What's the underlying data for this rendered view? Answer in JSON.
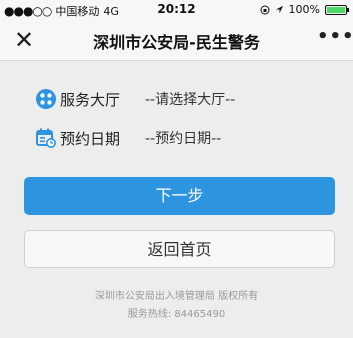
{
  "status_bar": {
    "signal": "●●●○○",
    "carrier": "中国移动",
    "network": "4G",
    "time": "20:12",
    "battery_text": "100%",
    "battery_level": 1.0
  },
  "navbar": {
    "close_label": "✕",
    "title": "深圳市公安局-民生警务",
    "more_label": "•••"
  },
  "form": {
    "service_label": "服务大厅",
    "service_value": "--请选择大厅--",
    "date_label": "预约日期",
    "date_value": "--预约日期--"
  },
  "buttons": {
    "next_label": "下一步",
    "home_label": "返回首页"
  },
  "footer": {
    "org_text": "深圳市公安局出入境管理局 版权所有",
    "hotline_text": "服务热线:  84465490"
  },
  "colors": {
    "primary": "#2d95e0",
    "icon": "#2d95e0",
    "background": "#ededed"
  }
}
